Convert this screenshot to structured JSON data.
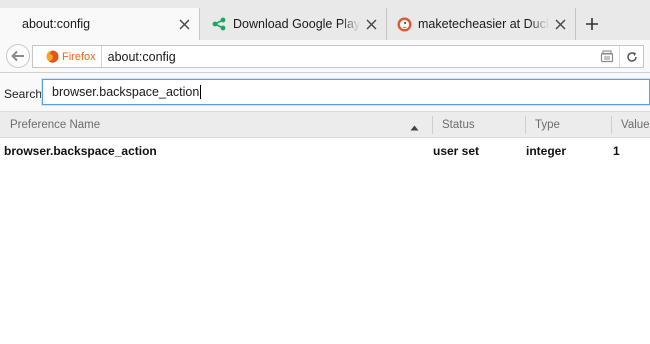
{
  "tabs": [
    {
      "label": "about:config",
      "active": true
    },
    {
      "label": "Download Google Play Servi",
      "icon": "share-icon",
      "icon_color": "#1fa463"
    },
    {
      "label": "maketecheasier at DuckDuck",
      "icon": "duckduckgo-icon",
      "icon_color": "#de5833"
    }
  ],
  "new_tab": {
    "label": "+"
  },
  "navbar": {
    "identity_label": "Firefox",
    "url": "about:config"
  },
  "search": {
    "label": "Search:",
    "value": "browser.backspace_action"
  },
  "table": {
    "columns": [
      "Preference Name",
      "Status",
      "Type",
      "Value"
    ],
    "sort_column": "Preference Name",
    "rows": [
      {
        "name": "browser.backspace_action",
        "status": "user set",
        "type": "integer",
        "value": "1"
      }
    ]
  },
  "colors": {
    "firefox_orange": "#e36b1f",
    "focus_blue": "#5b9ee8",
    "tab_strip": "#e9e9e9",
    "toolbar": "#f9f9f9"
  }
}
